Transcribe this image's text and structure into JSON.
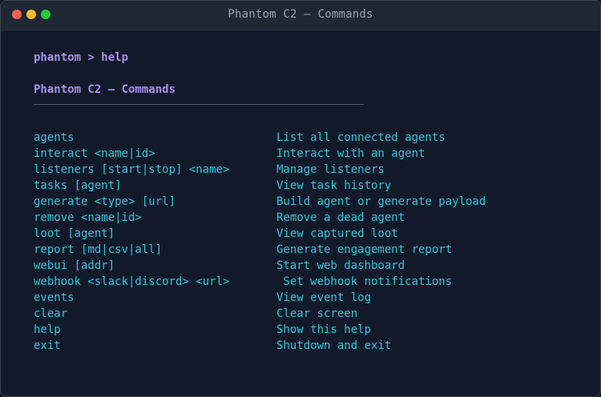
{
  "window": {
    "title": "Phantom C2 — Commands"
  },
  "terminal": {
    "prompt": "phantom > help",
    "heading": "Phantom C2 — Commands",
    "commands": [
      {
        "cmd": "agents",
        "desc": "List all connected agents"
      },
      {
        "cmd": "interact <name|id>",
        "desc": "Interact with an agent"
      },
      {
        "cmd": "listeners [start|stop] <name>",
        "desc": "Manage listeners"
      },
      {
        "cmd": "tasks [agent]",
        "desc": "View task history"
      },
      {
        "cmd": "generate <type> [url]",
        "desc": "Build agent or generate payload"
      },
      {
        "cmd": "remove <name|id>",
        "desc": "Remove a dead agent"
      },
      {
        "cmd": "loot [agent]",
        "desc": "View captured loot"
      },
      {
        "cmd": "report [md|csv|all]",
        "desc": "Generate engagement report"
      },
      {
        "cmd": "webui [addr]",
        "desc": "Start web dashboard"
      },
      {
        "cmd": "webhook <slack|discord> <url>",
        "desc": " Set webhook notifications"
      },
      {
        "cmd": "events",
        "desc": "View event log"
      },
      {
        "cmd": "clear",
        "desc": "Clear screen"
      },
      {
        "cmd": "help",
        "desc": "Show this help"
      },
      {
        "cmd": "exit",
        "desc": "Shutdown and exit"
      }
    ]
  },
  "colors": {
    "prompt": "#a98ff0",
    "command": "#2fc6de",
    "background": "#121a2a"
  }
}
